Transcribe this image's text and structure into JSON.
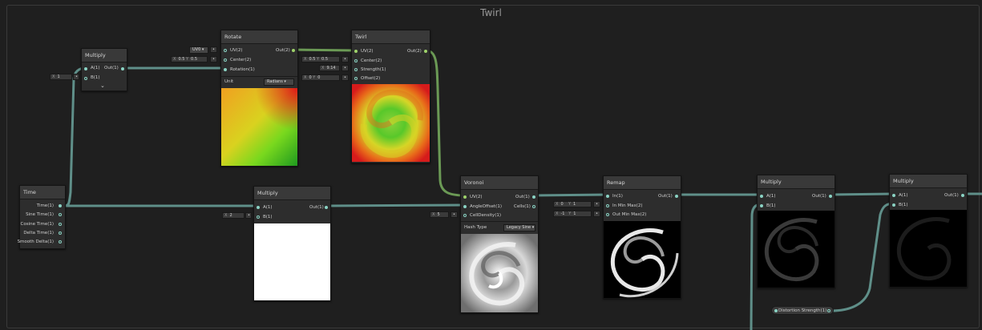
{
  "group": {
    "title": "Twirl"
  },
  "nodes": {
    "multiply1": {
      "title": "Multiply",
      "in_a": "A(1)",
      "in_b": "B(1)",
      "out": "Out(1)",
      "b_x": "X",
      "b_val": "1"
    },
    "rotate": {
      "title": "Rotate",
      "in_uv": "UV(2)",
      "in_center": "Center(2)",
      "in_rotation": "Rotation(1)",
      "out": "Out(2)",
      "uv_drop": "UV0 ▾",
      "center_x_ax": "X",
      "center_x": "0.5",
      "center_y_ax": "Y",
      "center_y": "0.5",
      "unit_label": "Unit",
      "unit_value": "Radians ▾"
    },
    "twirl": {
      "title": "Twirl",
      "in_uv": "UV(2)",
      "in_center": "Center(2)",
      "in_strength": "Strength(1)",
      "in_offset": "Offset(2)",
      "out": "Out(2)",
      "center_x_ax": "X",
      "center_x": "0.5",
      "center_y_ax": "Y",
      "center_y": "0.5",
      "strength_x_ax": "X",
      "strength": "9.14",
      "offset_x_ax": "X",
      "offset_x": "0",
      "offset_y_ax": "Y",
      "offset_y": "0"
    },
    "time": {
      "title": "Time",
      "out_time": "Time(1)",
      "out_sine": "Sine Time(1)",
      "out_cosine": "Cosine Time(1)",
      "out_delta": "Delta Time(1)",
      "out_smooth": "Smooth Delta(1)"
    },
    "multiply2": {
      "title": "Multiply",
      "in_a": "A(1)",
      "in_b": "B(1)",
      "out": "Out(1)",
      "b_x": "X",
      "b_val": "2"
    },
    "voronoi": {
      "title": "Voronoi",
      "in_uv": "UV(2)",
      "in_angle": "AngleOffset(1)",
      "in_density": "CellDensity(1)",
      "out": "Out(1)",
      "out_cells": "Cells(1)",
      "density_x": "X",
      "density_val": "5",
      "hash_label": "Hash Type",
      "hash_value": "Legacy Sine ▾"
    },
    "remap": {
      "title": "Remap",
      "in": "In(1)",
      "in_minmax": "In Min Max(2)",
      "out_minmax": "Out Min Max(2)",
      "out": "Out(1)",
      "inmm_x_ax": "X",
      "inmm_x": "0",
      "inmm_y_ax": "Y",
      "inmm_y": "1",
      "outmm_x_ax": "X",
      "outmm_x": "-1",
      "outmm_y_ax": "Y",
      "outmm_y": "1"
    },
    "multiply3": {
      "title": "Multiply",
      "in_a": "A(1)",
      "in_b": "B(1)",
      "out": "Out(1)"
    },
    "multiply4": {
      "title": "Multiply",
      "in_a": "A(1)",
      "in_b": "B(1)",
      "out": "Out(1)"
    }
  },
  "properties": {
    "distortion": "Distortion Strength(1)"
  },
  "colors": {
    "wire_float": "#5f8f89",
    "wire_vec2": "#6b9a55",
    "port_float": "#8ad3c4",
    "port_vec2": "#9fd36b"
  }
}
